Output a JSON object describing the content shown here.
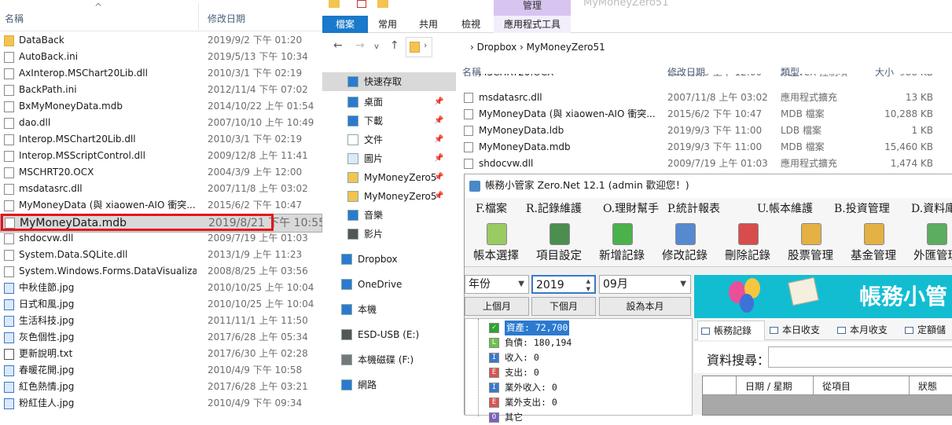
{
  "left_pane": {
    "col_name": "名稱",
    "col_date": "修改日期",
    "files": [
      {
        "name": "DataBack",
        "date": "2019/9/2 下午 01:20",
        "icon": "folder-icon"
      },
      {
        "name": "AutoBack.ini",
        "date": "2019/5/13 下午 10:34",
        "icon": "settings-file-icon"
      },
      {
        "name": "AxInterop.MSChart20Lib.dll",
        "date": "2010/3/1 下午 02:19",
        "icon": "dll-file-icon"
      },
      {
        "name": "BackPath.ini",
        "date": "2012/11/4 下午 07:02",
        "icon": "settings-file-icon"
      },
      {
        "name": "BxMyMoneyData.mdb",
        "date": "2014/10/22 上午 01:54",
        "icon": "file-icon"
      },
      {
        "name": "dao.dll",
        "date": "2007/10/10 上午 10:49",
        "icon": "dll-file-icon"
      },
      {
        "name": "Interop.MSChart20Lib.dll",
        "date": "2010/3/1 下午 02:19",
        "icon": "dll-file-icon"
      },
      {
        "name": "Interop.MSScriptControl.dll",
        "date": "2009/12/8 上午 11:41",
        "icon": "dll-file-icon"
      },
      {
        "name": "MSCHRT20.OCX",
        "date": "2004/3/9 上午 12:00",
        "icon": "file-icon"
      },
      {
        "name": "msdatasrc.dll",
        "date": "2007/11/8 上午 03:02",
        "icon": "dll-file-icon"
      },
      {
        "name": "MyMoneyData (與 xiaowen-AIO 衝突...",
        "date": "2015/6/2 下午 10:47",
        "icon": "file-icon"
      },
      {
        "name": "MyMoneyData.mdb",
        "date": "2019/8/21 下午 10:55",
        "icon": "file-icon",
        "selected": true
      },
      {
        "name": "shdocvw.dll",
        "date": "2009/7/19 上午 01:03",
        "icon": "dll-file-icon"
      },
      {
        "name": "System.Data.SQLite.dll",
        "date": "2013/1/9 上午 11:23",
        "icon": "dll-file-icon"
      },
      {
        "name": "System.Windows.Forms.DataVisualizat...",
        "date": "2008/8/25 上午 03:56",
        "icon": "dll-file-icon"
      },
      {
        "name": "中秋佳節.jpg",
        "date": "2010/10/25 上午 10:04",
        "icon": "image-file-icon"
      },
      {
        "name": "日式和風.jpg",
        "date": "2010/10/25 上午 10:04",
        "icon": "image-file-icon"
      },
      {
        "name": "生活科技.jpg",
        "date": "2011/11/1 上午 11:50",
        "icon": "image-file-icon"
      },
      {
        "name": "灰色個性.jpg",
        "date": "2017/6/28 上午 05:34",
        "icon": "image-file-icon"
      },
      {
        "name": "更新說明.txt",
        "date": "2017/6/30 上午 02:28",
        "icon": "text-file-icon"
      },
      {
        "name": "春暖花開.jpg",
        "date": "2010/4/9 下午 10:58",
        "icon": "image-file-icon"
      },
      {
        "name": "紅色熱情.jpg",
        "date": "2017/6/28 上午 03:21",
        "icon": "image-file-icon"
      },
      {
        "name": "粉紅佳人.jpg",
        "date": "2010/4/9 下午 09:34",
        "icon": "image-file-icon"
      }
    ]
  },
  "explorer": {
    "ribbon_context_label": "管理",
    "window_title": "MyMoneyZero51",
    "tabs": [
      "檔案",
      "常用",
      "共用",
      "檢視",
      "應用程式工具"
    ],
    "breadcrumb": "›  Dropbox  ›  MyMoneyZero51",
    "nav": [
      {
        "label": "快速存取",
        "icon": "star-icon",
        "highlight": true
      },
      {
        "label": "桌面",
        "icon": "desktop-icon",
        "pin": true
      },
      {
        "label": "下載",
        "icon": "download-icon",
        "pin": true
      },
      {
        "label": "文件",
        "icon": "document-icon",
        "pin": true
      },
      {
        "label": "圖片",
        "icon": "pictures-icon",
        "pin": true
      },
      {
        "label": "MyMoneyZero5",
        "icon": "folder-icon",
        "pin": true
      },
      {
        "label": "MyMoneyZero5",
        "icon": "folder-icon",
        "pin": true
      },
      {
        "label": "音樂",
        "icon": "music-icon"
      },
      {
        "label": "影片",
        "icon": "video-icon"
      },
      {
        "label": "Dropbox",
        "icon": "dropbox-icon"
      },
      {
        "label": "OneDrive",
        "icon": "cloud-icon"
      },
      {
        "label": "本機",
        "icon": "computer-icon"
      },
      {
        "label": "ESD-USB (E:)",
        "icon": "usb-drive-icon"
      },
      {
        "label": "本機磁碟 (F:)",
        "icon": "disk-icon"
      },
      {
        "label": "網路",
        "icon": "network-icon"
      }
    ],
    "columns": {
      "name": "名稱",
      "date": "修改日期",
      "type": "類型",
      "size": "大小"
    },
    "partial_row": {
      "name": "MSCHRT20.OCX",
      "date": "2004/3/9 上午 12:00",
      "type": "ActiveX 控制項",
      "size": "988 KB"
    },
    "rows": [
      {
        "name": "msdatasrc.dll",
        "date": "2007/11/8 上午 03:02",
        "type": "應用程式擴充",
        "size": "13 KB"
      },
      {
        "name": "MyMoneyData (與 xiaowen-AIO 衝突...",
        "date": "2015/6/2 下午 10:47",
        "type": "MDB 檔案",
        "size": "10,288 KB"
      },
      {
        "name": "MyMoneyData.ldb",
        "date": "2019/9/3 下午 11:00",
        "type": "LDB 檔案",
        "size": "1 KB"
      },
      {
        "name": "MyMoneyData.mdb",
        "date": "2019/9/3 下午 11:00",
        "type": "MDB 檔案",
        "size": "15,460 KB"
      },
      {
        "name": "shdocvw.dll",
        "date": "2009/7/19 上午 01:03",
        "type": "應用程式擴充",
        "size": "1,474 KB"
      }
    ]
  },
  "app": {
    "title": "帳務小管家 Zero.Net 12.1 (admin 歡迎您！)",
    "menu": [
      "F.檔案",
      "R.記錄維護",
      "O.理財幫手",
      "P.統計報表",
      "U.帳本維護",
      "B.投資管理",
      "D.資料庫"
    ],
    "toolbar": [
      {
        "label": "帳本選擇",
        "icon": "books-icon"
      },
      {
        "label": "項目設定",
        "icon": "settings-table-icon"
      },
      {
        "label": "新增記錄",
        "icon": "add-record-icon"
      },
      {
        "label": "修改記錄",
        "icon": "edit-record-icon"
      },
      {
        "label": "刪除記錄",
        "icon": "delete-record-icon"
      },
      {
        "label": "股票管理",
        "icon": "stock-icon"
      },
      {
        "label": "基金管理",
        "icon": "fund-icon"
      },
      {
        "label": "外匯管理",
        "icon": "forex-icon"
      }
    ],
    "year_mode": "年份",
    "year_value": "2019",
    "month_value": "09月",
    "prev_month": "上個月",
    "next_month": "下個月",
    "set_this_month": "設為本月",
    "tree": [
      {
        "label": "資產: 72,700",
        "badge": "✓",
        "color": "#2ea52e",
        "highlight": true
      },
      {
        "label": "負債: 180,194",
        "badge": "L",
        "color": "#6cc24a"
      },
      {
        "label": "收入: 0",
        "badge": "I",
        "color": "#3a78c9"
      },
      {
        "label": "支出: 0",
        "badge": "E",
        "color": "#d9534f"
      },
      {
        "label": "業外收入: 0",
        "badge": "I",
        "color": "#3a78c9"
      },
      {
        "label": "業外支出: 0",
        "badge": "E",
        "color": "#d9534f"
      },
      {
        "label": "其它",
        "badge": "O",
        "color": "#7b5fbf"
      }
    ],
    "banner_title": "帳務小管",
    "tabs": [
      "帳務記錄",
      "本日收支",
      "本月收支",
      "定額儲"
    ],
    "search_label": "資料搜尋：",
    "grid_headers": [
      "日期 / 星期",
      "從項目",
      "狀態"
    ]
  }
}
